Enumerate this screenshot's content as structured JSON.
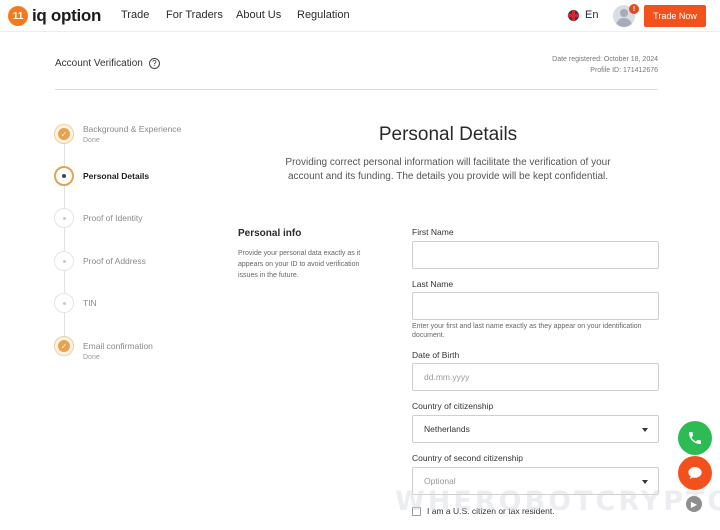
{
  "header": {
    "logo_badge": "11",
    "logo_text": "iq option",
    "nav": [
      "Trade",
      "For Traders",
      "About Us",
      "Regulation"
    ],
    "language": "En",
    "notification_count": "!",
    "trade_button": "Trade Now"
  },
  "account": {
    "title": "Account Verification",
    "help_icon": "?",
    "date_registered": "Date registered: October 18, 2024",
    "profile_id": "Profile ID: 171412676"
  },
  "steps": [
    {
      "label": "Background & Experience",
      "status": "Done",
      "state": "done"
    },
    {
      "label": "Personal Details",
      "status": "",
      "state": "current"
    },
    {
      "label": "Proof of Identity",
      "status": "",
      "state": "pending"
    },
    {
      "label": "Proof of Address",
      "status": "",
      "state": "pending"
    },
    {
      "label": "TIN",
      "status": "",
      "state": "pending"
    },
    {
      "label": "Email confirmation",
      "status": "Done",
      "state": "done"
    }
  ],
  "main": {
    "title": "Personal Details",
    "description": "Providing correct personal information will facilitate the verification of your account and its funding. The details you provide will be kept confidential.",
    "section_title": "Personal info",
    "section_desc": "Provide your personal data exactly as it appears on your ID to avoid verification issues in the future."
  },
  "form": {
    "first_name_label": "First Name",
    "first_name_value": "",
    "last_name_label": "Last Name",
    "last_name_value": "",
    "name_hint": "Enter your first and last name exactly as they appear on your identification document.",
    "dob_label": "Date of Birth",
    "dob_placeholder": "dd.mm.yyyy",
    "citizenship_label": "Country of citizenship",
    "citizenship_value": "Netherlands",
    "second_citizenship_label": "Country of second citizenship",
    "second_citizenship_placeholder": "Optional",
    "us_checkbox_label": "I am a U.S. citizen or tax resident."
  },
  "watermark": "WHEROBOTCRYPTO.COM",
  "colors": {
    "brand_orange": "#f2511b",
    "step_done": "#e8a24f",
    "phone_green": "#2dbb53"
  }
}
